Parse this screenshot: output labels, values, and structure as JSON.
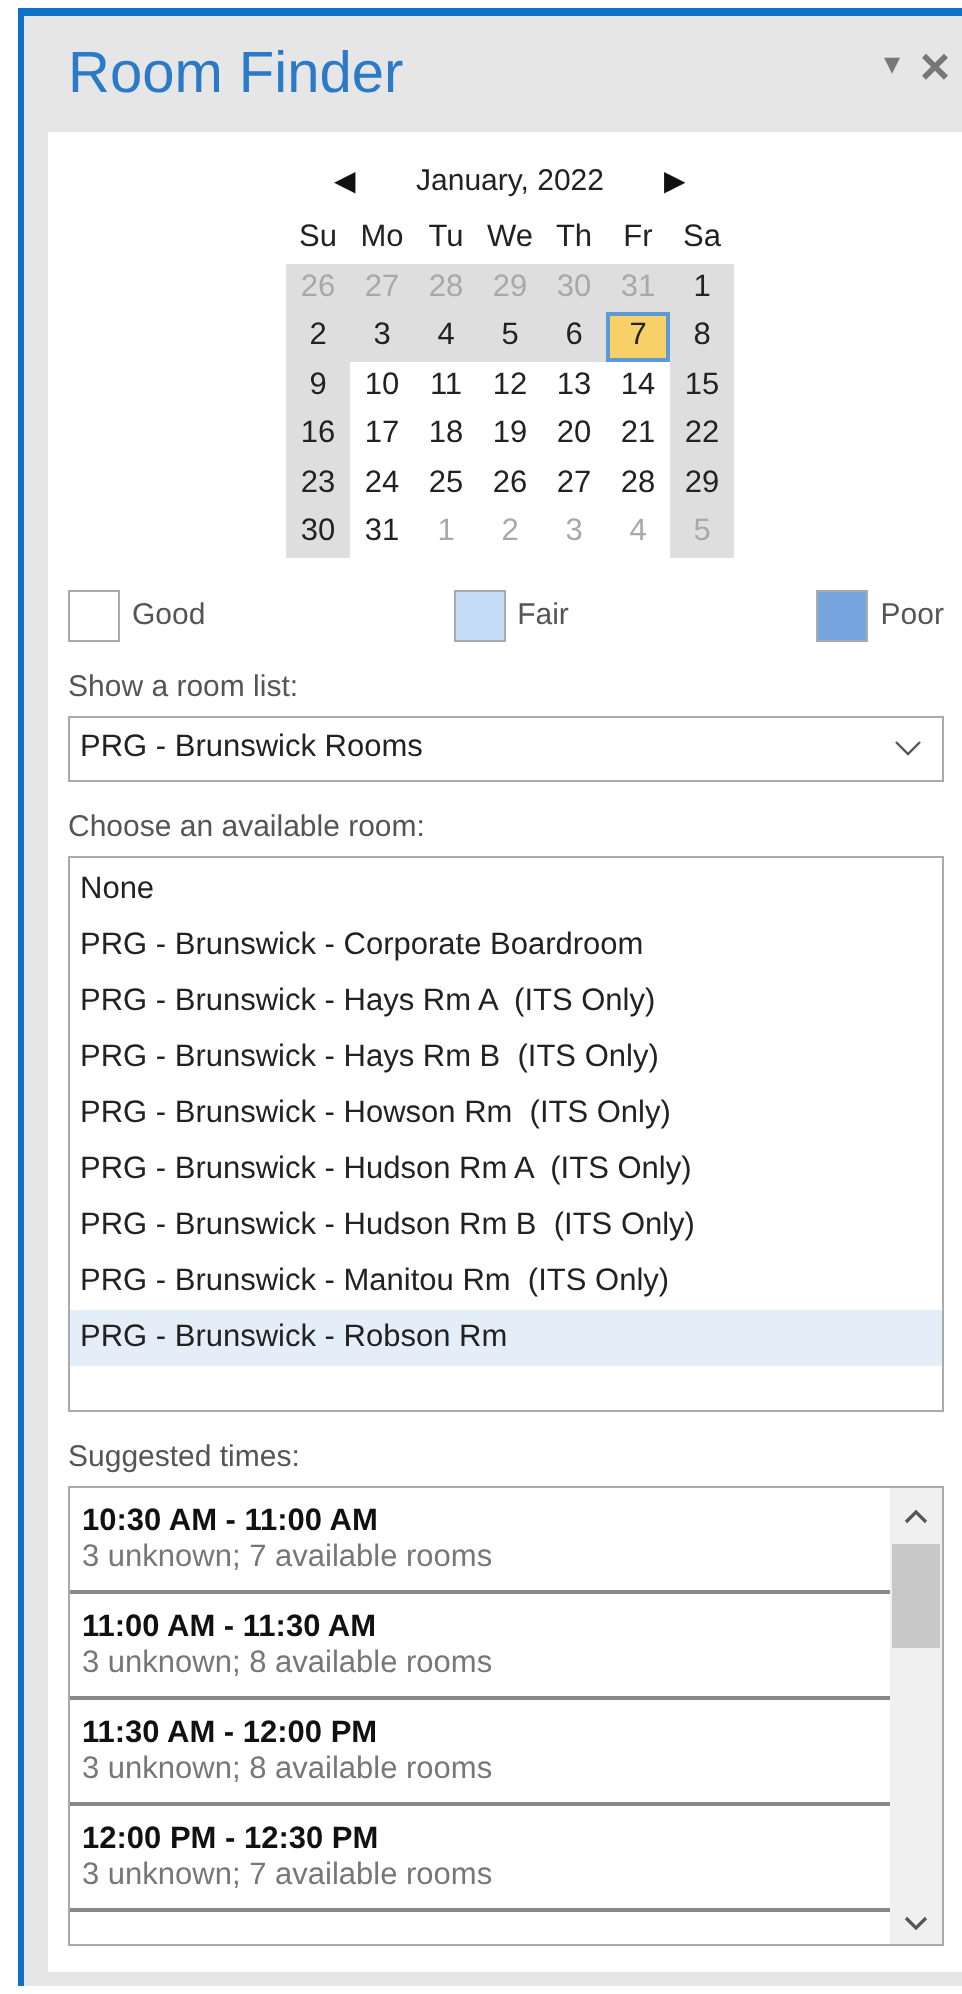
{
  "panel": {
    "title": "Room Finder",
    "menu_icon": "▾",
    "close_icon": "×"
  },
  "calendar": {
    "month": "January, 2022",
    "prev": "◀",
    "next": "▶",
    "weekdays": [
      "Su",
      "Mo",
      "Tu",
      "We",
      "Th",
      "Fr",
      "Sa"
    ],
    "weeks": [
      [
        {
          "label": "26",
          "muted": true,
          "shaded": true,
          "selected": false
        },
        {
          "label": "27",
          "muted": true,
          "shaded": true,
          "selected": false
        },
        {
          "label": "28",
          "muted": true,
          "shaded": true,
          "selected": false
        },
        {
          "label": "29",
          "muted": true,
          "shaded": true,
          "selected": false
        },
        {
          "label": "30",
          "muted": true,
          "shaded": true,
          "selected": false
        },
        {
          "label": "31",
          "muted": true,
          "shaded": true,
          "selected": false
        },
        {
          "label": "1",
          "muted": false,
          "shaded": true,
          "selected": false
        }
      ],
      [
        {
          "label": "2",
          "muted": false,
          "shaded": true,
          "selected": false
        },
        {
          "label": "3",
          "muted": false,
          "shaded": true,
          "selected": false
        },
        {
          "label": "4",
          "muted": false,
          "shaded": true,
          "selected": false
        },
        {
          "label": "5",
          "muted": false,
          "shaded": true,
          "selected": false
        },
        {
          "label": "6",
          "muted": false,
          "shaded": true,
          "selected": false
        },
        {
          "label": "7",
          "muted": false,
          "shaded": false,
          "selected": true
        },
        {
          "label": "8",
          "muted": false,
          "shaded": true,
          "selected": false
        }
      ],
      [
        {
          "label": "9",
          "muted": false,
          "shaded": true,
          "selected": false
        },
        {
          "label": "10",
          "muted": false,
          "shaded": false,
          "selected": false
        },
        {
          "label": "11",
          "muted": false,
          "shaded": false,
          "selected": false
        },
        {
          "label": "12",
          "muted": false,
          "shaded": false,
          "selected": false
        },
        {
          "label": "13",
          "muted": false,
          "shaded": false,
          "selected": false
        },
        {
          "label": "14",
          "muted": false,
          "shaded": false,
          "selected": false
        },
        {
          "label": "15",
          "muted": false,
          "shaded": true,
          "selected": false
        }
      ],
      [
        {
          "label": "16",
          "muted": false,
          "shaded": true,
          "selected": false
        },
        {
          "label": "17",
          "muted": false,
          "shaded": false,
          "selected": false
        },
        {
          "label": "18",
          "muted": false,
          "shaded": false,
          "selected": false
        },
        {
          "label": "19",
          "muted": false,
          "shaded": false,
          "selected": false
        },
        {
          "label": "20",
          "muted": false,
          "shaded": false,
          "selected": false
        },
        {
          "label": "21",
          "muted": false,
          "shaded": false,
          "selected": false
        },
        {
          "label": "22",
          "muted": false,
          "shaded": true,
          "selected": false
        }
      ],
      [
        {
          "label": "23",
          "muted": false,
          "shaded": true,
          "selected": false
        },
        {
          "label": "24",
          "muted": false,
          "shaded": false,
          "selected": false
        },
        {
          "label": "25",
          "muted": false,
          "shaded": false,
          "selected": false
        },
        {
          "label": "26",
          "muted": false,
          "shaded": false,
          "selected": false
        },
        {
          "label": "27",
          "muted": false,
          "shaded": false,
          "selected": false
        },
        {
          "label": "28",
          "muted": false,
          "shaded": false,
          "selected": false
        },
        {
          "label": "29",
          "muted": false,
          "shaded": true,
          "selected": false
        }
      ],
      [
        {
          "label": "30",
          "muted": false,
          "shaded": true,
          "selected": false
        },
        {
          "label": "31",
          "muted": false,
          "shaded": false,
          "selected": false
        },
        {
          "label": "1",
          "muted": true,
          "shaded": false,
          "selected": false
        },
        {
          "label": "2",
          "muted": true,
          "shaded": false,
          "selected": false
        },
        {
          "label": "3",
          "muted": true,
          "shaded": false,
          "selected": false
        },
        {
          "label": "4",
          "muted": true,
          "shaded": false,
          "selected": false
        },
        {
          "label": "5",
          "muted": true,
          "shaded": true,
          "selected": false
        }
      ]
    ]
  },
  "legend": [
    {
      "label": "Good",
      "color": "#ffffff"
    },
    {
      "label": "Fair",
      "color": "#c5dcf8"
    },
    {
      "label": "Poor",
      "color": "#77a6df"
    }
  ],
  "room_list": {
    "label": "Show a room list:",
    "value": "PRG - Brunswick Rooms"
  },
  "rooms": {
    "label": "Choose an available room:",
    "items": [
      {
        "label": "None",
        "selected": false
      },
      {
        "label": "PRG - Brunswick - Corporate Boardroom",
        "selected": false
      },
      {
        "label": "PRG - Brunswick - Hays Rm A  (ITS Only)",
        "selected": false
      },
      {
        "label": "PRG - Brunswick - Hays Rm B  (ITS Only)",
        "selected": false
      },
      {
        "label": "PRG - Brunswick - Howson Rm  (ITS Only)",
        "selected": false
      },
      {
        "label": "PRG - Brunswick - Hudson Rm A  (ITS Only)",
        "selected": false
      },
      {
        "label": "PRG - Brunswick - Hudson Rm B  (ITS Only)",
        "selected": false
      },
      {
        "label": "PRG - Brunswick - Manitou Rm  (ITS Only)",
        "selected": false
      },
      {
        "label": "PRG - Brunswick - Robson Rm",
        "selected": true
      }
    ]
  },
  "suggested": {
    "label": "Suggested times:",
    "items": [
      {
        "time": "10:30 AM - 11:00 AM",
        "detail": "3 unknown; 7 available rooms"
      },
      {
        "time": "11:00 AM - 11:30 AM",
        "detail": "3 unknown; 8 available rooms"
      },
      {
        "time": "11:30 AM - 12:00 PM",
        "detail": "3 unknown; 8 available rooms"
      },
      {
        "time": "12:00 PM - 12:30 PM",
        "detail": "3 unknown; 7 available rooms"
      }
    ]
  }
}
